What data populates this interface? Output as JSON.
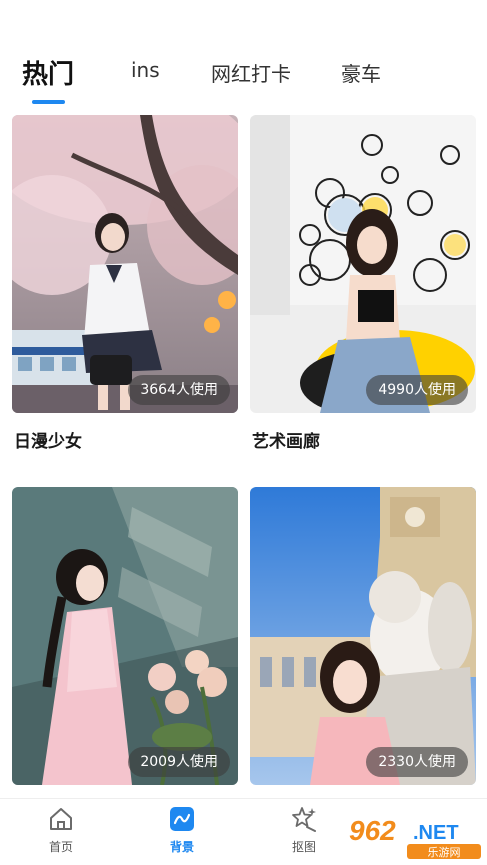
{
  "tabs": [
    {
      "label": "热门",
      "active": true
    },
    {
      "label": "ins",
      "active": false
    },
    {
      "label": "网红打卡",
      "active": false
    },
    {
      "label": "豪车",
      "active": false
    }
  ],
  "accent_color": "#1e88f0",
  "cards": [
    {
      "title": "日漫少女",
      "usage": "3664人使用",
      "scene": "cherry-blossom-schoolgirl"
    },
    {
      "title": "艺术画廊",
      "usage": "4990人使用",
      "scene": "art-gallery-mirrors"
    },
    {
      "title": "",
      "usage": "2009人使用",
      "scene": "hanfu-girl-with-roses"
    },
    {
      "title": "",
      "usage": "2330人使用",
      "scene": "girl-with-angel-statue"
    }
  ],
  "bottom_nav": [
    {
      "label": "首页",
      "icon": "home-icon",
      "active": false
    },
    {
      "label": "背景",
      "icon": "background-icon",
      "active": true
    },
    {
      "label": "抠图",
      "icon": "cutout-icon",
      "active": false
    }
  ],
  "watermark": {
    "brand": "962",
    "suffix": ".NET",
    "caption": "乐游网"
  }
}
